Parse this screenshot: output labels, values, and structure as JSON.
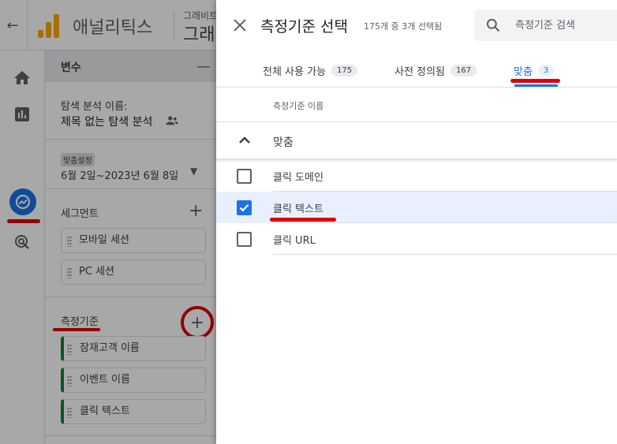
{
  "app": {
    "back_glyph": "←",
    "name": "애널리틱스",
    "account_line1": "그래비트",
    "account_line2": "그래"
  },
  "variables": {
    "title": "변수",
    "minimize_glyph": "—",
    "exploration_label": "탐색 분석 이름:",
    "exploration_name": "제목 없는 탐색 분석",
    "date_chip": "맞춤설정",
    "date_range": "6월 2일~2023년 6월 8일",
    "segments_title": "세그먼트",
    "segments": [
      "모바일 세션",
      "PC 세션"
    ],
    "metrics_title": "측정기준",
    "metrics": [
      "잠재고객 이름",
      "이벤트 이름",
      "클릭 텍스트"
    ],
    "add_glyph": "+"
  },
  "dialog": {
    "title": "측정기준 선택",
    "count": "175개 중 3개 선택됨",
    "search_placeholder": "측정기준 검색",
    "tabs": [
      {
        "label": "전체 사용 가능",
        "badge": "175"
      },
      {
        "label": "사전 정의됨",
        "badge": "167"
      },
      {
        "label": "맞춤",
        "badge": "3"
      }
    ],
    "active_tab": "맞춤",
    "column_header": "측정기준 이름",
    "group_label": "맞춤",
    "options": [
      {
        "label": "클릭 도메인",
        "checked": false
      },
      {
        "label": "클릭 텍스트",
        "checked": true
      },
      {
        "label": "클릭 URL",
        "checked": false
      }
    ]
  },
  "colors": {
    "accent": "#1a73e8",
    "annotation": "#e00000",
    "logo": "#f9ab00",
    "metric_bar": "#188038"
  },
  "icons": {
    "back": "arrow-back-icon",
    "close": "close-icon",
    "search": "search-icon",
    "group": "chevron-up-icon",
    "share": "people-icon"
  }
}
